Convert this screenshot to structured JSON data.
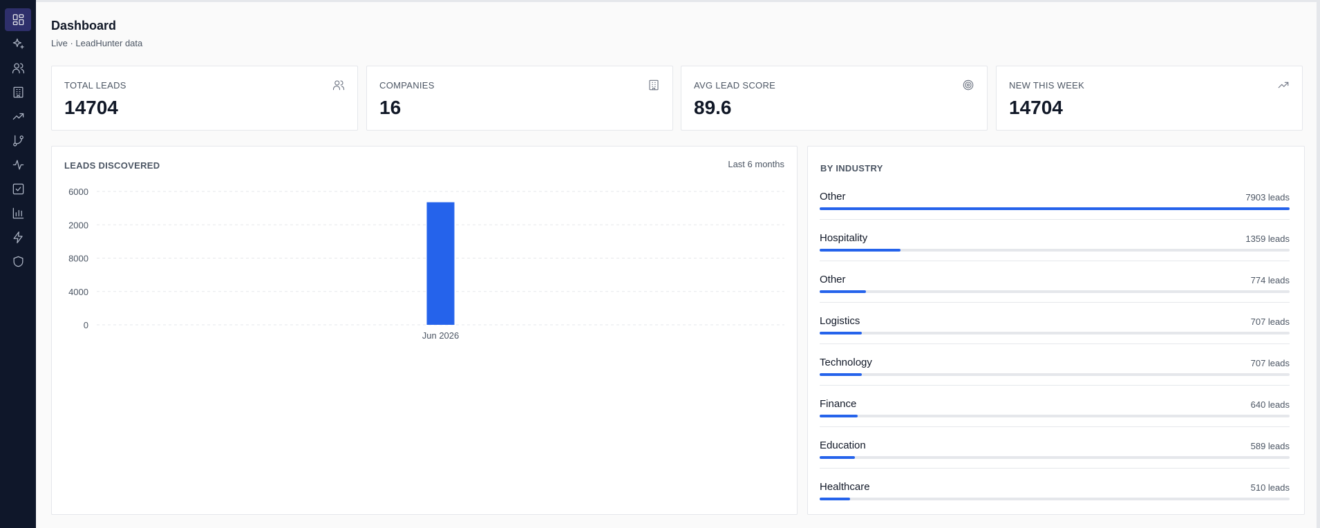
{
  "sidebar": {
    "items": [
      {
        "name": "dashboard",
        "icon": "layout-grid-icon",
        "active": true
      },
      {
        "name": "sparkles",
        "icon": "sparkles-icon",
        "active": false
      },
      {
        "name": "leads",
        "icon": "users-icon",
        "active": false
      },
      {
        "name": "companies",
        "icon": "building-icon",
        "active": false
      },
      {
        "name": "trends",
        "icon": "trending-up-icon",
        "active": false
      },
      {
        "name": "pipeline",
        "icon": "git-branch-icon",
        "active": false
      },
      {
        "name": "activity",
        "icon": "activity-icon",
        "active": false
      },
      {
        "name": "tasks",
        "icon": "check-square-icon",
        "active": false
      },
      {
        "name": "reports",
        "icon": "bar-chart-icon",
        "active": false
      },
      {
        "name": "automations",
        "icon": "zap-icon",
        "active": false
      },
      {
        "name": "security",
        "icon": "shield-icon",
        "active": false
      }
    ]
  },
  "header": {
    "title": "Dashboard",
    "subtitle": "Live · LeadHunter data"
  },
  "stats": [
    {
      "label": "TOTAL LEADS",
      "value": "14704",
      "icon": "users-icon"
    },
    {
      "label": "COMPANIES",
      "value": "16",
      "icon": "building-icon"
    },
    {
      "label": "AVG LEAD SCORE",
      "value": "89.6",
      "icon": "target-icon"
    },
    {
      "label": "NEW THIS WEEK",
      "value": "14704",
      "icon": "trending-up-icon"
    }
  ],
  "leads_chart": {
    "heading": "LEADS DISCOVERED",
    "range": "Last 6 months"
  },
  "chart_data": {
    "type": "bar",
    "categories": [
      "Jun 2026"
    ],
    "values": [
      14704
    ],
    "yticks": [
      "6000",
      "2000",
      "8000",
      "4000",
      "0"
    ],
    "ylim": [
      0,
      16000
    ],
    "grid": true,
    "bar_color": "#2563eb"
  },
  "industry": {
    "heading": "BY INDUSTRY",
    "max": 7903,
    "items": [
      {
        "name": "Other",
        "count": 7903,
        "label": "7903 leads"
      },
      {
        "name": "Hospitality",
        "count": 1359,
        "label": "1359 leads"
      },
      {
        "name": "Other",
        "count": 774,
        "label": "774 leads"
      },
      {
        "name": "Logistics",
        "count": 707,
        "label": "707 leads"
      },
      {
        "name": "Technology",
        "count": 707,
        "label": "707 leads"
      },
      {
        "name": "Finance",
        "count": 640,
        "label": "640 leads"
      },
      {
        "name": "Education",
        "count": 589,
        "label": "589 leads"
      },
      {
        "name": "Healthcare",
        "count": 510,
        "label": "510 leads"
      }
    ]
  },
  "colors": {
    "accent": "#2563eb",
    "sidebar_bg": "#0f172a",
    "sidebar_active": "#2e2f6b"
  }
}
